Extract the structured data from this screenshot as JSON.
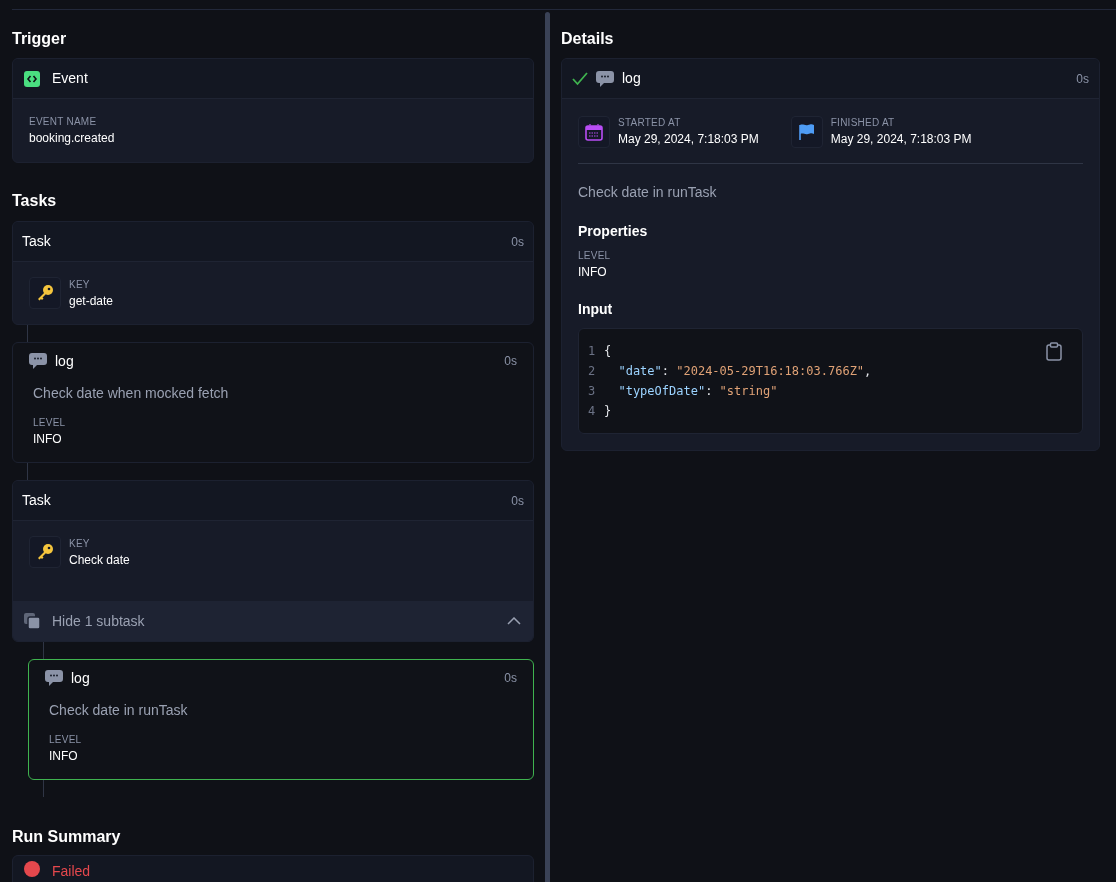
{
  "trigger": {
    "heading": "Trigger",
    "card": {
      "title": "Event",
      "field_label": "EVENT NAME",
      "field_value": "booking.created"
    }
  },
  "tasks": {
    "heading": "Tasks",
    "items": [
      {
        "kind": "task",
        "title": "Task",
        "duration": "0s",
        "key_label": "KEY",
        "key_value": "get-date"
      },
      {
        "kind": "log",
        "title": "log",
        "duration": "0s",
        "message": "Check date when mocked fetch",
        "level_label": "LEVEL",
        "level_value": "INFO",
        "selected": false
      },
      {
        "kind": "task",
        "title": "Task",
        "duration": "0s",
        "key_label": "KEY",
        "key_value": "Check date",
        "subtasks_toggle": {
          "label": "Hide 1 subtask",
          "expanded": true
        },
        "children": [
          {
            "kind": "log",
            "title": "log",
            "duration": "0s",
            "message": "Check date in runTask",
            "level_label": "LEVEL",
            "level_value": "INFO",
            "selected": true
          }
        ]
      }
    ]
  },
  "run_summary": {
    "heading": "Run Summary",
    "status": "Failed"
  },
  "details": {
    "heading": "Details",
    "header": {
      "done": true,
      "title": "log",
      "duration": "0s"
    },
    "times": [
      {
        "kind": "start",
        "label": "STARTED AT",
        "value": "May 29, 2024, 7:18:03 PM"
      },
      {
        "kind": "finish",
        "label": "FINISHED AT",
        "value": "May 29, 2024, 7:18:03 PM"
      }
    ],
    "message": "Check date in runTask",
    "properties_heading": "Properties",
    "level_label": "LEVEL",
    "level_value": "INFO",
    "input_heading": "Input",
    "code_lines": [
      {
        "number": "1",
        "tokens": [
          {
            "kind": "punct",
            "text": "{"
          }
        ]
      },
      {
        "number": "2",
        "tokens": [
          {
            "kind": "key",
            "text": "  \"date\""
          },
          {
            "kind": "punct",
            "text": ": "
          },
          {
            "kind": "string",
            "text": "\"2024-05-29T16:18:03.766Z\""
          },
          {
            "kind": "punct",
            "text": ","
          }
        ]
      },
      {
        "number": "3",
        "tokens": [
          {
            "kind": "key",
            "text": "  \"typeOfDate\""
          },
          {
            "kind": "punct",
            "text": ": "
          },
          {
            "kind": "string",
            "text": "\"string\""
          }
        ]
      },
      {
        "number": "4",
        "tokens": [
          {
            "kind": "punct",
            "text": "}"
          }
        ]
      }
    ]
  }
}
